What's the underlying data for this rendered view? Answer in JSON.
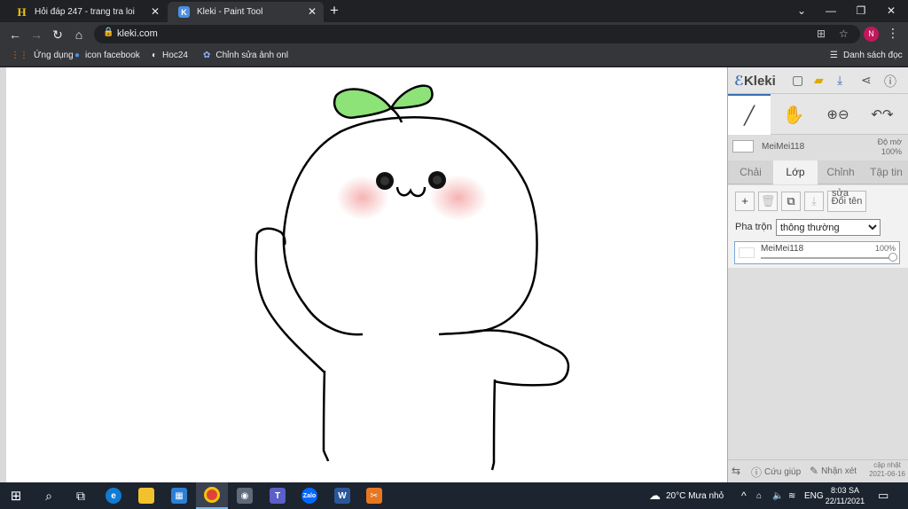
{
  "browser": {
    "tabs": [
      {
        "title": "Hỏi đáp 247 - trang tra loi",
        "favicon": "H"
      },
      {
        "title": "Kleki - Paint Tool",
        "favicon": "K"
      }
    ],
    "url": "kleki.com",
    "avatar_letter": "N",
    "bookmarks": [
      {
        "label": "Ứng dụng",
        "icon": "apps-grid-icon"
      },
      {
        "label": "icon facebook",
        "icon": "globe-icon"
      },
      {
        "label": "Hoc24",
        "icon": "globe-icon"
      },
      {
        "label": "Chỉnh sửa ảnh onl",
        "icon": "photo-editor-icon"
      }
    ],
    "reading_list": "Danh sách đọc"
  },
  "kleki": {
    "logo": "Kleki",
    "layer_name": "MeiMei118",
    "opacity_label": "Độ mờ",
    "opacity_value": "100%",
    "tabs": [
      "Chải",
      "Lớp",
      "Chỉnh",
      "Tập tin"
    ],
    "active_tab": "Lớp",
    "rename_button": "Đổi tên",
    "rename_overlay": "sửa",
    "blend_label": "Pha trộn",
    "blend_value": "thông thường",
    "layers": [
      {
        "name": "MeiMei118",
        "opacity": "100%"
      }
    ],
    "help": "Cứu giúp",
    "feedback": "Nhận xét",
    "update_label": "cập nhật",
    "update_date": "2021-06-16"
  },
  "taskbar": {
    "weather": "20°C  Mưa nhỏ",
    "language": "ENG",
    "time": "8:03 SA",
    "date": "22/11/2021"
  }
}
